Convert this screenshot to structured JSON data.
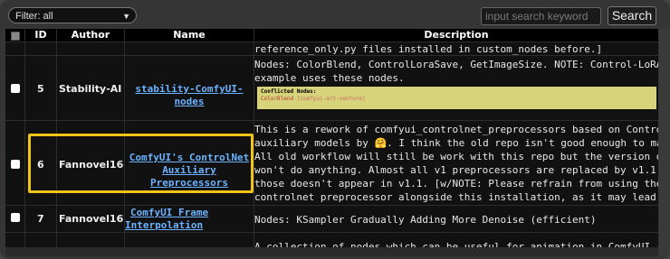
{
  "filter": {
    "label": "Filter: all",
    "chevron": "chevron-down-icon"
  },
  "search": {
    "placeholder": "input search keyword",
    "button": "Search"
  },
  "table": {
    "columns": [
      "ID",
      "Author",
      "Name",
      "Description"
    ],
    "rows": [
      {
        "id": "",
        "author": "",
        "name": "",
        "desc": "reference_only.py files installed in custom_nodes before.]"
      },
      {
        "id": "5",
        "author": "Stability-AI",
        "name": "stability-ComfyUI-nodes",
        "desc": "Nodes: ColorBlend, ControlLoraSave, GetImageSize. NOTE: Control-LoRA recolor\nexample uses these nodes.",
        "conflict": {
          "title": "Conflicted Nodes:",
          "item": "ColorBlend",
          "ext": "[comfyui-art-venture]"
        }
      },
      {
        "id": "6",
        "author": "Fannovel16",
        "name": "ComfyUI's ControlNet Auxiliary Preprocessors",
        "name_line1": "ComfyUI's ControlNet",
        "name_line2": "Auxiliary Preprocessors",
        "desc": "This is a rework of comfyui_controlnet_preprocessors based on ControlNet\nauxiliary models by 🤗. I think the old repo isn't good enough to maintain.\nAll old workflow will still be work with this repo but the version option\nwon't do anything. Almost all v1 preprocessors are replaced by v1.1 except\nthose doesn't appear in v1.1. [w/NOTE: Please refrain from using the\ncontrolnet preprocessor alongside this installation, as it may lead to\nconflicts and prevent proper recognition.]"
      },
      {
        "id": "7",
        "author": "Fannovel16",
        "name": "ComfyUI Frame Interpolation",
        "name_line1": "ComfyUI Frame",
        "name_line2": "Interpolation",
        "desc": "Nodes: KSampler Gradually Adding More Denoise (efficient)"
      },
      {
        "id": "",
        "author": "",
        "name": "",
        "desc": "A collection of nodes which can be useful for animation in ComfyUI. The main"
      }
    ]
  },
  "colors": {
    "highlight": "#f0c419",
    "link": "#6db3ff",
    "conflict_bg": "#d6d37a"
  }
}
